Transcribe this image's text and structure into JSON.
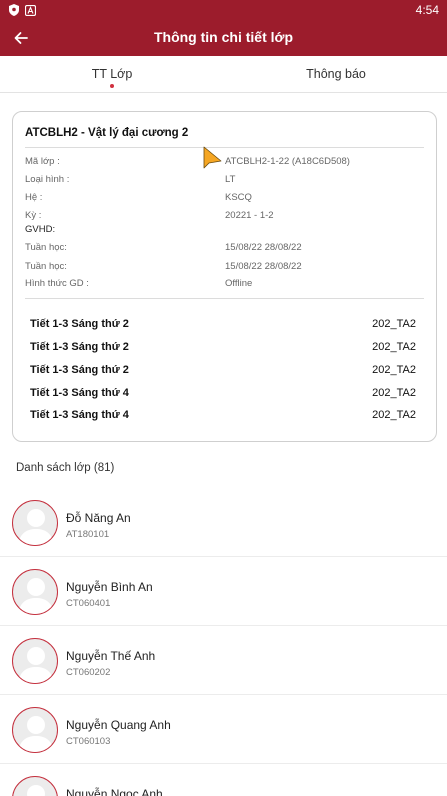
{
  "status_bar": {
    "time": "4:54"
  },
  "app_bar": {
    "title": "Thông tin chi tiết lớp"
  },
  "tabs": [
    {
      "label": "TT Lớp",
      "active": true
    },
    {
      "label": "Thông báo",
      "active": false
    }
  ],
  "course": {
    "title": "ATCBLH2 - Vật lý đại cương 2",
    "info": [
      {
        "label": "Mã lớp :",
        "value": "ATCBLH2-1-22 (A18C6D508)"
      },
      {
        "label": "Loại hình :",
        "value": "LT"
      },
      {
        "label": "Hệ :",
        "value": "KSCQ"
      },
      {
        "label": "Kỳ :",
        "value": "20221 - 1-2"
      },
      {
        "label": "GVHD:",
        "value": ""
      },
      {
        "label": "Tuần học:",
        "value": "15/08/22 28/08/22"
      },
      {
        "label": "Tuần học:",
        "value": "15/08/22 28/08/22"
      },
      {
        "label": "Hình thức GD :",
        "value": "Offline"
      }
    ],
    "schedule": [
      {
        "time": "Tiết 1-3 Sáng thứ 2",
        "room": "202_TA2"
      },
      {
        "time": "Tiết 1-3 Sáng thứ 2",
        "room": "202_TA2"
      },
      {
        "time": "Tiết 1-3 Sáng thứ 2",
        "room": "202_TA2"
      },
      {
        "time": "Tiết 1-3 Sáng thứ 4",
        "room": "202_TA2"
      },
      {
        "time": "Tiết 1-3 Sáng thứ 4",
        "room": "202_TA2"
      }
    ]
  },
  "class_list": {
    "header": "Danh sách lớp (81)",
    "students": [
      {
        "name": "Đỗ Năng An",
        "code": "AT180101"
      },
      {
        "name": "Nguyễn Bình An",
        "code": "CT060401"
      },
      {
        "name": "Nguyễn Thế Anh",
        "code": "CT060202"
      },
      {
        "name": "Nguyễn Quang Anh",
        "code": "CT060103"
      },
      {
        "name": "Nguyễn Ngọc Anh",
        "code": ""
      }
    ]
  },
  "colors": {
    "primary": "#9c1c2c",
    "accent_dot": "#d0303f",
    "avatar_border": "#c4303e"
  }
}
